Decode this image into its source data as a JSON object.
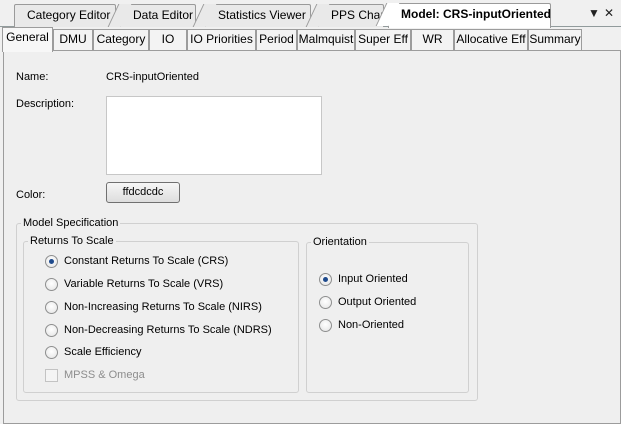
{
  "doc_tabs": [
    {
      "label": "Category Editor"
    },
    {
      "label": "Data Editor"
    },
    {
      "label": "Statistics Viewer"
    },
    {
      "label": "PPS Chart"
    },
    {
      "label": "Model: CRS-inputOriented"
    }
  ],
  "window_controls": {
    "dropdown": "▼",
    "close": "✕"
  },
  "tabs": [
    {
      "label": "General"
    },
    {
      "label": "DMU"
    },
    {
      "label": "Category"
    },
    {
      "label": "IO"
    },
    {
      "label": "IO Priorities"
    },
    {
      "label": "Period"
    },
    {
      "label": "Malmquist"
    },
    {
      "label": "Super Eff"
    },
    {
      "label": "WR"
    },
    {
      "label": "Allocative Eff"
    },
    {
      "label": "Summary"
    }
  ],
  "active_tab": "General",
  "form": {
    "name_label": "Name:",
    "name_value": "CRS-inputOriented",
    "description_label": "Description:",
    "description_value": "",
    "color_label": "Color:",
    "color_button": "ffdcdcdc"
  },
  "model_spec": {
    "title": "Model Specification",
    "returns_to_scale": {
      "title": "Returns To Scale",
      "options": [
        {
          "label": "Constant Returns To Scale (CRS)",
          "checked": true
        },
        {
          "label": "Variable Returns To Scale (VRS)",
          "checked": false
        },
        {
          "label": "Non-Increasing Returns To Scale (NIRS)",
          "checked": false
        },
        {
          "label": "Non-Decreasing Returns To Scale (NDRS)",
          "checked": false
        },
        {
          "label": "Scale Efficiency",
          "checked": false
        }
      ],
      "mpss_label": "MPSS & Omega",
      "mpss_checked": false,
      "mpss_enabled": false
    },
    "orientation": {
      "title": "Orientation",
      "options": [
        {
          "label": "Input Oriented",
          "checked": true
        },
        {
          "label": "Output Oriented",
          "checked": false
        },
        {
          "label": "Non-Oriented",
          "checked": false
        }
      ]
    }
  },
  "colors": {
    "radio_dot": "#1e4a8c",
    "panel_bg": "#efefef"
  }
}
